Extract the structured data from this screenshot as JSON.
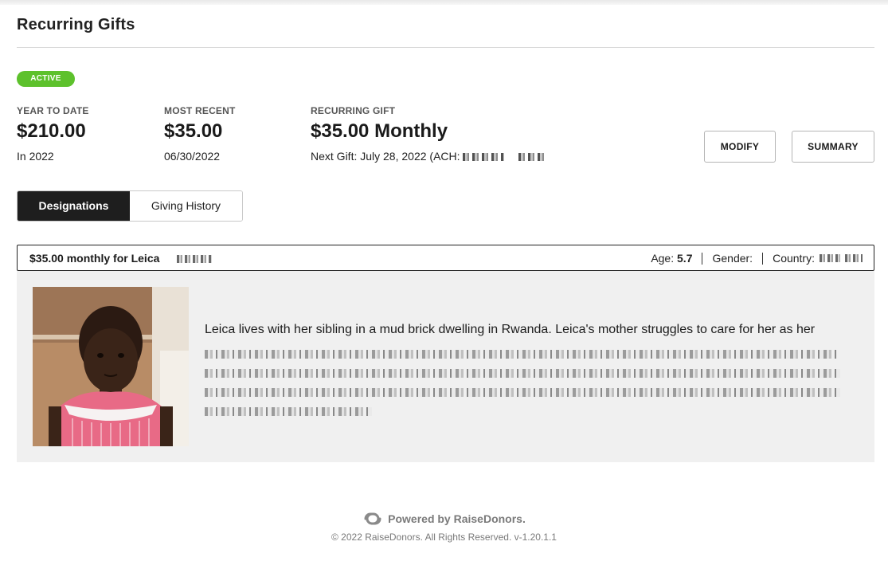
{
  "page": {
    "title": "Recurring Gifts"
  },
  "status": {
    "label": "ACTIVE",
    "color": "#5dc12c"
  },
  "stats": {
    "year_to_date": {
      "label": "YEAR TO DATE",
      "value": "$210.00",
      "sub": "In 2022"
    },
    "most_recent": {
      "label": "MOST RECENT",
      "value": "$35.00",
      "sub": "06/30/2022"
    },
    "recurring_gift": {
      "label": "RECURRING GIFT",
      "value": "$35.00 Monthly",
      "sub": "Next Gift: July 28, 2022 (ACH:"
    }
  },
  "actions": {
    "modify_label": "MODIFY",
    "summary_label": "SUMMARY"
  },
  "tabs": [
    {
      "label": "Designations",
      "active": true
    },
    {
      "label": "Giving History",
      "active": false
    }
  ],
  "designation": {
    "title": "$35.00 monthly for Leica",
    "age_label": "Age:",
    "age_value": "5.7",
    "gender_label": "Gender:",
    "country_label": "Country:",
    "story": "Leica lives with her sibling in a mud brick dwelling in Rwanda. Leica's mother struggles to care for her as her"
  },
  "footer": {
    "brand": "Powered by RaiseDonors.",
    "copyright": "© 2022 RaiseDonors. All Rights Reserved. v-1.20.1.1"
  },
  "icons": {
    "brand_logo": "raisedonors-logo-icon"
  }
}
